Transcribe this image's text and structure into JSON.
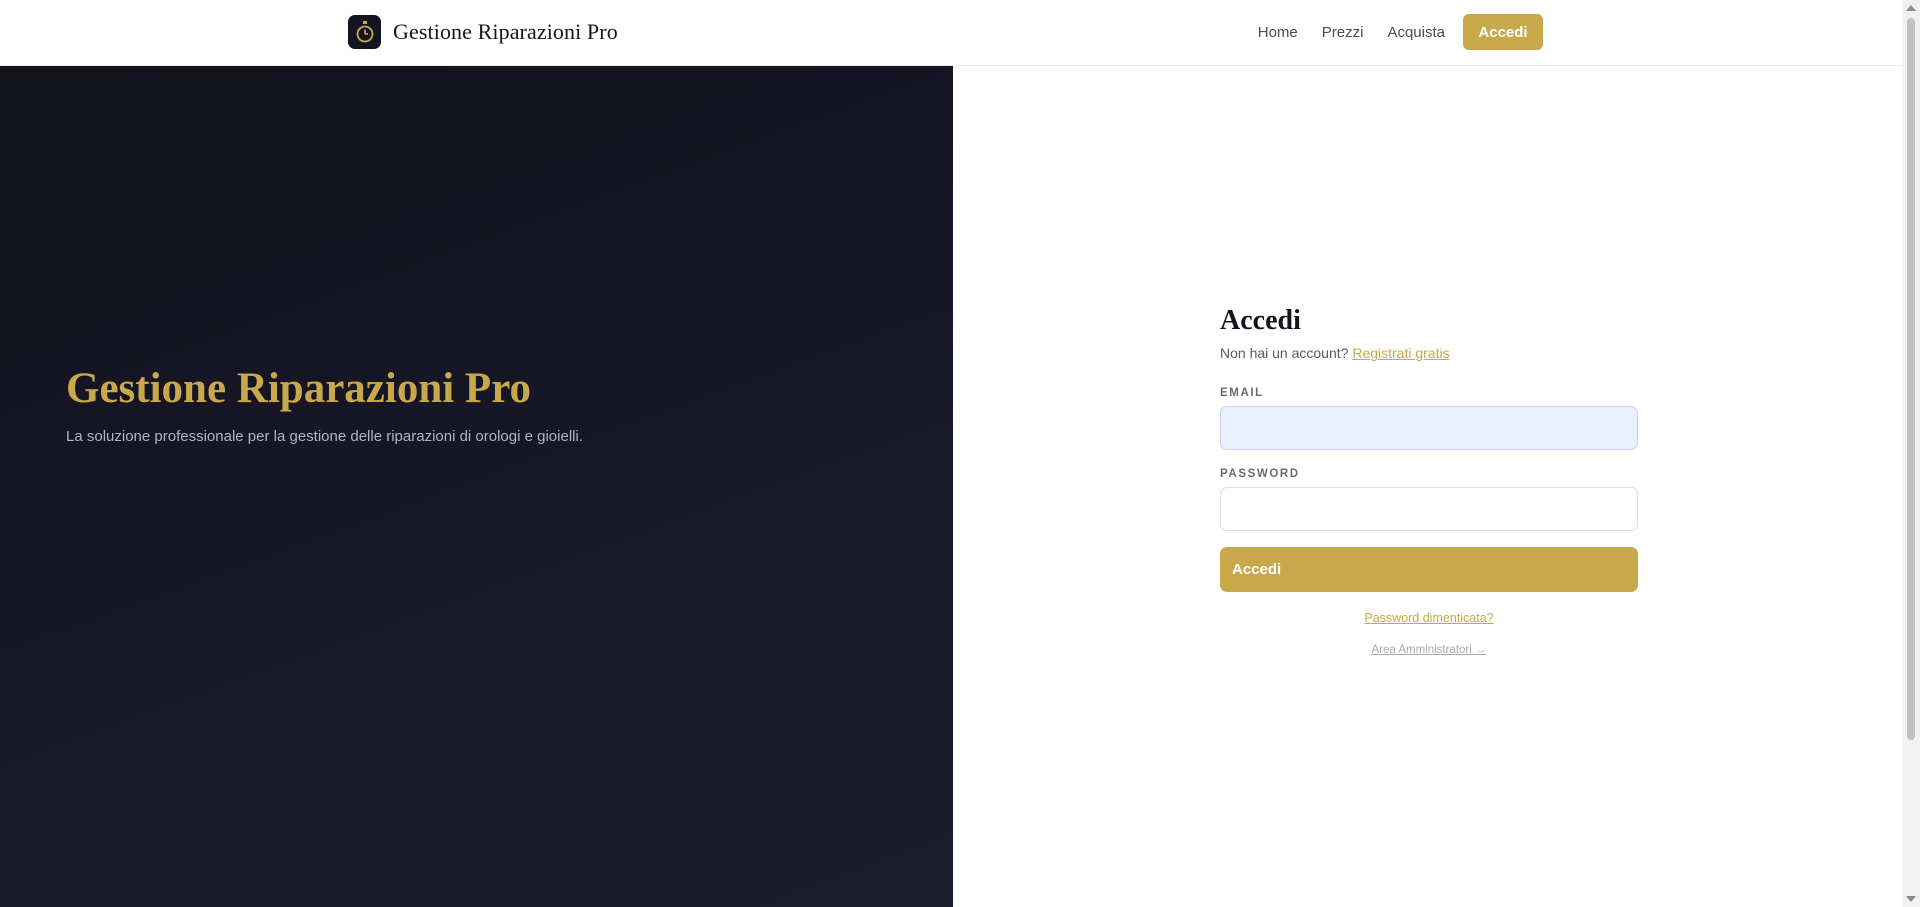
{
  "navbar": {
    "brand_name": "Gestione Riparazioni Pro",
    "brand_icon": "stopwatch-icon",
    "links": [
      "Home",
      "Prezzi",
      "Acquista"
    ],
    "login_button": "Accedi"
  },
  "hero": {
    "title": "Gestione Riparazioni Pro",
    "subtitle": "La soluzione professionale per la gestione delle riparazioni di orologi e gioielli."
  },
  "login_form": {
    "title": "Accedi",
    "no_account_text": "Non hai un account?",
    "register_link": "Registrati gratis",
    "email_label": "EMAIL",
    "email_value": "",
    "password_label": "PASSWORD",
    "password_value": "",
    "submit_label": "Accedi",
    "forgot_password": "Password dimenticata?",
    "admin_area": "Area Amministratori →"
  },
  "colors": {
    "accent_gold": "#c9a84c",
    "hero_dark": "#14141f",
    "text_dark": "#151521"
  }
}
